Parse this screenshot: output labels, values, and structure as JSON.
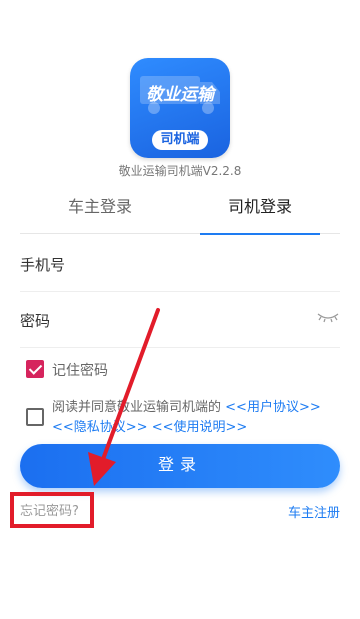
{
  "app": {
    "logo_title": "敬业运输",
    "logo_badge": "司机端",
    "version": "敬业运输司机端V2.2.8"
  },
  "tabs": [
    {
      "label": "车主登录",
      "active": false
    },
    {
      "label": "司机登录",
      "active": true
    }
  ],
  "form": {
    "phone_label": "手机号",
    "phone_value": "",
    "password_label": "密码",
    "password_value": "",
    "eye_icon": "eye-closed-icon"
  },
  "remember": {
    "label": "记住密码",
    "checked": true
  },
  "agreement": {
    "checked": false,
    "text": "阅读并同意敬业运输司机端的",
    "user_agreement": "<<用户协议>>",
    "privacy_policy": "<<隐私协议>>",
    "usage_guide": "<<使用说明>>"
  },
  "login_button": "登录",
  "forgot_password": "忘记密码?",
  "owner_register": "车主注册",
  "colors": {
    "accent": "#1e7cf2",
    "checkbox_checked": "#d6245d",
    "annotation": "#e21c2a"
  }
}
